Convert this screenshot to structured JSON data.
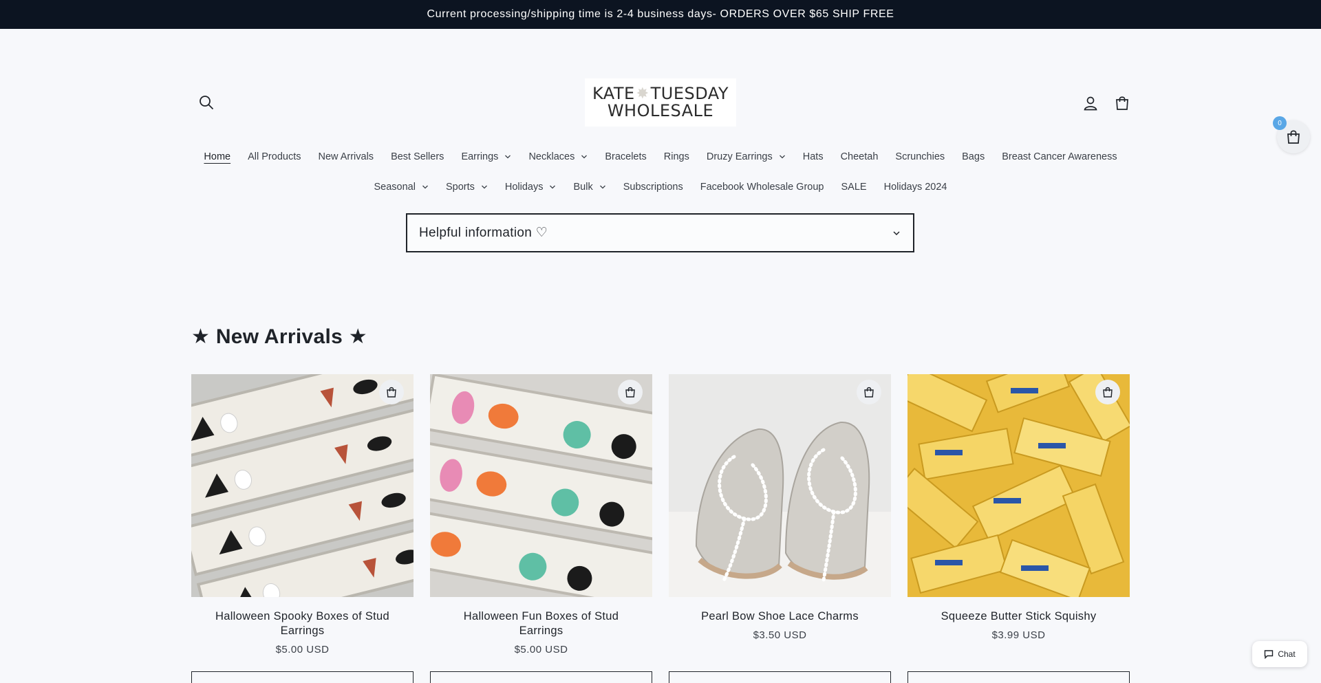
{
  "announcement": "Current processing/shipping time is 2-4 business days- ORDERS OVER $65 SHIP FREE",
  "logo": {
    "line1_left": "KATE",
    "line1_right": "TUESDAY",
    "line2": "WHOLESALE"
  },
  "nav_row1": [
    {
      "label": "Home",
      "dropdown": false
    },
    {
      "label": "All Products",
      "dropdown": false
    },
    {
      "label": "New Arrivals",
      "dropdown": false
    },
    {
      "label": "Best Sellers",
      "dropdown": false
    },
    {
      "label": "Earrings",
      "dropdown": true
    },
    {
      "label": "Necklaces",
      "dropdown": true
    },
    {
      "label": "Bracelets",
      "dropdown": false
    },
    {
      "label": "Rings",
      "dropdown": false
    },
    {
      "label": "Druzy Earrings",
      "dropdown": true
    },
    {
      "label": "Hats",
      "dropdown": false
    },
    {
      "label": "Cheetah",
      "dropdown": false
    },
    {
      "label": "Scrunchies",
      "dropdown": false
    },
    {
      "label": "Bags",
      "dropdown": false
    },
    {
      "label": "Breast Cancer Awareness",
      "dropdown": false
    }
  ],
  "nav_row2": [
    {
      "label": "Seasonal",
      "dropdown": true
    },
    {
      "label": "Sports",
      "dropdown": true
    },
    {
      "label": "Holidays",
      "dropdown": true
    },
    {
      "label": "Bulk",
      "dropdown": true
    },
    {
      "label": "Subscriptions",
      "dropdown": false
    },
    {
      "label": "Facebook Wholesale Group",
      "dropdown": false
    },
    {
      "label": "SALE",
      "dropdown": false
    },
    {
      "label": "Holidays 2024",
      "dropdown": false
    }
  ],
  "floating_cart": {
    "count": "0"
  },
  "accordion": {
    "title": "Helpful information ♡"
  },
  "new_arrivals": {
    "title": "★ New Arrivals ★",
    "products": [
      {
        "name": "Halloween Spooky Boxes of Stud Earrings",
        "price": "$5.00 USD"
      },
      {
        "name": "Halloween Fun Boxes of Stud Earrings",
        "price": "$5.00 USD"
      },
      {
        "name": "Pearl Bow Shoe Lace Charms",
        "price": "$3.50 USD"
      },
      {
        "name": "Squeeze Butter Stick Squishy",
        "price": "$3.99 USD"
      }
    ]
  },
  "chat": {
    "label": "Chat"
  },
  "icons": {
    "search": "search-icon",
    "account": "account-icon",
    "cart": "cart-icon",
    "chevron": "chevron-down-icon",
    "quick_add": "shopping-bag-plus-icon",
    "chat": "chat-bubble-icon"
  },
  "colors": {
    "announcement_bg": "#0c1421",
    "badge": "#5aa7e6",
    "text": "#1f2329"
  }
}
